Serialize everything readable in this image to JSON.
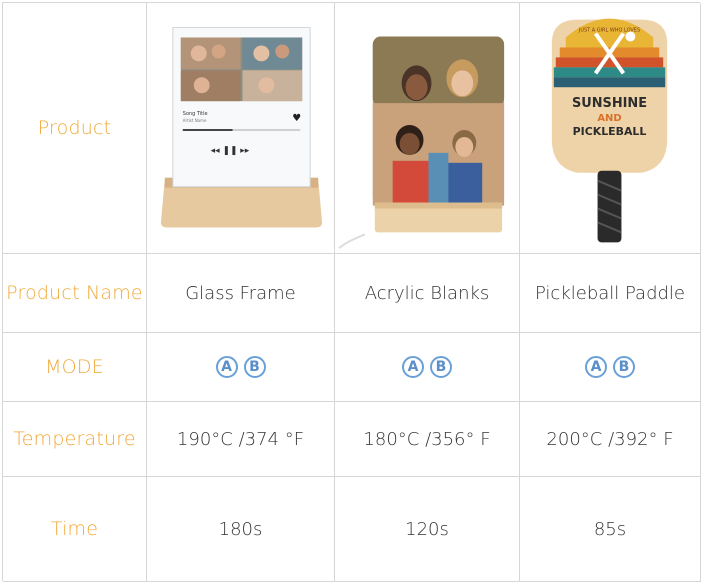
{
  "headers": {
    "product": "Product",
    "product_name": "Product Name",
    "mode": "MODE",
    "temperature": "Temperature",
    "time": "Time"
  },
  "products": [
    {
      "image": "glass-frame-photo",
      "name": "Glass Frame",
      "modes": [
        "A",
        "B"
      ],
      "temperature": "190°C /374 °F",
      "time": "180s",
      "image_text": {
        "song_title": "Song Title",
        "artist": "Artist Name"
      }
    },
    {
      "image": "acrylic-blanks-photo",
      "name": "Acrylic Blanks",
      "modes": [
        "A",
        "B"
      ],
      "temperature": "180°C /356° F",
      "time": "120s"
    },
    {
      "image": "pickleball-paddle-photo",
      "name": "Pickleball Paddle",
      "modes": [
        "A",
        "B"
      ],
      "temperature": "200°C /392° F",
      "time": "85s",
      "image_text": {
        "small": "JUST A GIRL WHO LOVES",
        "line1": "SUNSHINE",
        "line2": "AND",
        "line3": "PICKLEBALL"
      }
    }
  ],
  "colors": {
    "label": "#f0a93a",
    "badge": "#6aa0d8",
    "text": "#333333",
    "border": "#d6d6d6"
  }
}
